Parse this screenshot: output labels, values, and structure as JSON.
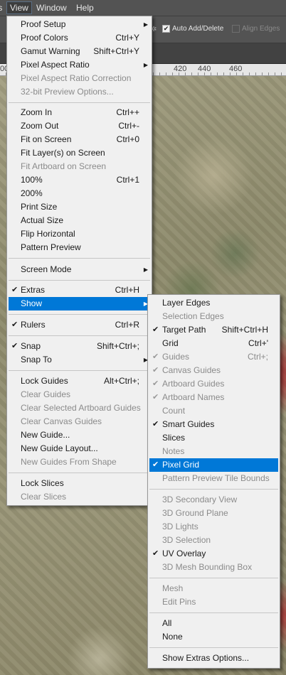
{
  "menubar": {
    "items": [
      {
        "label": "Fs"
      },
      {
        "label": "View"
      },
      {
        "label": "Window"
      },
      {
        "label": "Help"
      }
    ]
  },
  "options": {
    "auto_add_delete": {
      "label": "Auto Add/Delete",
      "checked": true
    },
    "align_edges": {
      "label": "Align Edges",
      "checked": false
    }
  },
  "ruler": {
    "ticks": [
      "00",
      "420",
      "440",
      "460"
    ]
  },
  "view_menu": {
    "items": [
      {
        "label": "Proof Setup",
        "submenu": true
      },
      {
        "label": "Proof Colors",
        "shortcut": "Ctrl+Y"
      },
      {
        "label": "Gamut Warning",
        "shortcut": "Shift+Ctrl+Y"
      },
      {
        "label": "Pixel Aspect Ratio",
        "submenu": true
      },
      {
        "label": "Pixel Aspect Ratio Correction",
        "disabled": true
      },
      {
        "label": "32-bit Preview Options...",
        "disabled": true
      },
      {
        "label": "Zoom In",
        "shortcut": "Ctrl++"
      },
      {
        "label": "Zoom Out",
        "shortcut": "Ctrl+-"
      },
      {
        "label": "Fit on Screen",
        "shortcut": "Ctrl+0"
      },
      {
        "label": "Fit Layer(s) on Screen"
      },
      {
        "label": "Fit Artboard on Screen",
        "disabled": true
      },
      {
        "label": "100%",
        "shortcut": "Ctrl+1"
      },
      {
        "label": "200%"
      },
      {
        "label": "Print Size"
      },
      {
        "label": "Actual Size"
      },
      {
        "label": "Flip Horizontal"
      },
      {
        "label": "Pattern Preview"
      },
      {
        "label": "Screen Mode",
        "submenu": true
      },
      {
        "label": "Extras",
        "shortcut": "Ctrl+H",
        "checked": true
      },
      {
        "label": "Show",
        "submenu": true,
        "highlighted": true
      },
      {
        "label": "Rulers",
        "shortcut": "Ctrl+R",
        "checked": true
      },
      {
        "label": "Snap",
        "shortcut": "Shift+Ctrl+;",
        "checked": true
      },
      {
        "label": "Snap To",
        "submenu": true
      },
      {
        "label": "Lock Guides",
        "shortcut": "Alt+Ctrl+;"
      },
      {
        "label": "Clear Guides",
        "disabled": true
      },
      {
        "label": "Clear Selected Artboard Guides",
        "disabled": true
      },
      {
        "label": "Clear Canvas Guides",
        "disabled": true
      },
      {
        "label": "New Guide..."
      },
      {
        "label": "New Guide Layout..."
      },
      {
        "label": "New Guides From Shape",
        "disabled": true
      },
      {
        "label": "Lock Slices"
      },
      {
        "label": "Clear Slices",
        "disabled": true
      }
    ]
  },
  "show_menu": {
    "items": [
      {
        "label": "Layer Edges"
      },
      {
        "label": "Selection Edges",
        "disabled": true
      },
      {
        "label": "Target Path",
        "shortcut": "Shift+Ctrl+H",
        "checked": true
      },
      {
        "label": "Grid",
        "shortcut": "Ctrl+'"
      },
      {
        "label": "Guides",
        "shortcut": "Ctrl+;",
        "checked": true,
        "disabled": true
      },
      {
        "label": "Canvas Guides",
        "checked": true,
        "disabled": true
      },
      {
        "label": "Artboard Guides",
        "checked": true,
        "disabled": true
      },
      {
        "label": "Artboard Names",
        "checked": true,
        "disabled": true
      },
      {
        "label": "Count",
        "disabled": true
      },
      {
        "label": "Smart Guides",
        "checked": true
      },
      {
        "label": "Slices"
      },
      {
        "label": "Notes",
        "disabled": true
      },
      {
        "label": "Pixel Grid",
        "checked": true,
        "highlighted": true
      },
      {
        "label": "Pattern Preview Tile Bounds",
        "disabled": true
      },
      {
        "label": "3D Secondary View",
        "disabled": true
      },
      {
        "label": "3D Ground Plane",
        "disabled": true
      },
      {
        "label": "3D Lights",
        "disabled": true
      },
      {
        "label": "3D Selection",
        "disabled": true
      },
      {
        "label": "UV Overlay",
        "checked": true
      },
      {
        "label": "3D Mesh Bounding Box",
        "disabled": true
      },
      {
        "label": "Mesh",
        "disabled": true
      },
      {
        "label": "Edit Pins",
        "disabled": true
      },
      {
        "label": "All"
      },
      {
        "label": "None"
      },
      {
        "label": "Show Extras Options..."
      }
    ]
  }
}
